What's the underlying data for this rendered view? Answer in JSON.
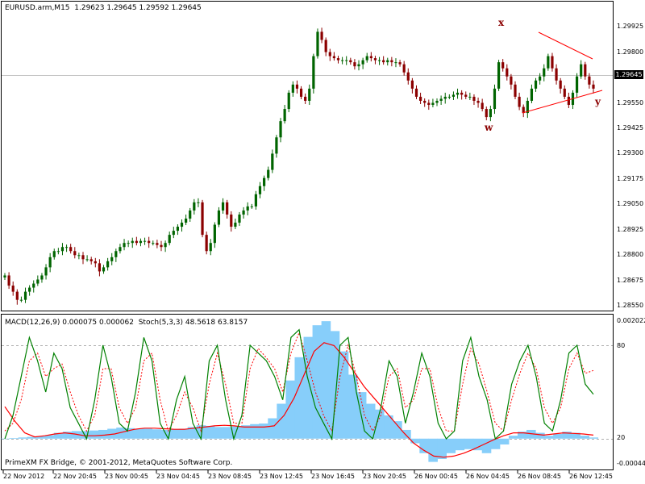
{
  "symbol_info": {
    "symbol": "EURUSD.arm,M15",
    "open": "1.29623",
    "high": "1.29645",
    "low": "1.29592",
    "close": "1.29645"
  },
  "indicator_info": {
    "macd": "MACD(12,26,9) 0.000075 0.000062",
    "stoch": "Stoch(5,3,3) 48.5618 63.8157"
  },
  "footer_text": "PrimeXM FX Bridge, © 2001-2012, MetaQuotes Software Corp.",
  "current_price": "1.29645",
  "price_axis": [
    "1.29925",
    "1.29800",
    "1.29675",
    "1.29550",
    "1.29425",
    "1.29300",
    "1.29175",
    "1.29050",
    "1.28925",
    "1.28800",
    "1.28675",
    "1.28550"
  ],
  "indicator_axis": [
    "0.002022",
    "80",
    "20",
    "-0.000447"
  ],
  "time_axis": [
    "22 Nov 2012",
    "22 Nov 20:45",
    "23 Nov 00:45",
    "23 Nov 04:45",
    "23 Nov 08:45",
    "23 Nov 12:45",
    "23 Nov 16:45",
    "23 Nov 20:45",
    "26 Nov 00:45",
    "26 Nov 04:45",
    "26 Nov 08:45",
    "26 Nov 12:45"
  ],
  "wave_labels": [
    "x",
    "w",
    "y"
  ],
  "colors": {
    "bull_candle": "#006400",
    "bear_candle": "#8b0000",
    "macd_histogram": "#87cefa",
    "macd_signal": "#ff0000",
    "stoch_main": "#008000",
    "stoch_signal": "#ff0000",
    "trendline": "#ff0000"
  },
  "chart_data": {
    "type": "candlestick",
    "timeframe": "M15",
    "ylim": [
      1.28535,
      1.29985
    ],
    "candles_close_approx": [
      1.287,
      1.2865,
      1.2862,
      1.2858,
      1.2858,
      1.2862,
      1.2864,
      1.2866,
      1.2868,
      1.287,
      1.2874,
      1.2879,
      1.2882,
      1.2882,
      1.2884,
      1.2884,
      1.2882,
      1.288,
      1.288,
      1.2878,
      1.2878,
      1.2877,
      1.2876,
      1.2872,
      1.2874,
      1.2877,
      1.2879,
      1.2882,
      1.2884,
      1.2886,
      1.2886,
      1.2887,
      1.2886,
      1.2887,
      1.2887,
      1.2886,
      1.2886,
      1.2885,
      1.2884,
      1.2886,
      1.289,
      1.2892,
      1.2894,
      1.2896,
      1.2898,
      1.2902,
      1.2906,
      1.2906,
      1.289,
      1.2882,
      1.2886,
      1.2895,
      1.2902,
      1.2906,
      1.29,
      1.2894,
      1.2896,
      1.29,
      1.2902,
      1.2904,
      1.2904,
      1.291,
      1.2914,
      1.2918,
      1.2922,
      1.293,
      1.2938,
      1.2946,
      1.2952,
      1.296,
      1.2964,
      1.2962,
      1.2958,
      1.2956,
      1.2962,
      1.2978,
      1.299,
      1.2986,
      1.298,
      1.2978,
      1.2977,
      1.2976,
      1.2976,
      1.2976,
      1.2975,
      1.2973,
      1.2974,
      1.2976,
      1.2978,
      1.2977,
      1.2976,
      1.2976,
      1.2975,
      1.2976,
      1.2975,
      1.2975,
      1.2974,
      1.297,
      1.2966,
      1.2962,
      1.2958,
      1.2956,
      1.2955,
      1.2954,
      1.2955,
      1.2956,
      1.2957,
      1.2958,
      1.2958,
      1.2959,
      1.296,
      1.2959,
      1.2958,
      1.2958,
      1.2956,
      1.2955,
      1.2952,
      1.2948,
      1.2952,
      1.2962,
      1.2975,
      1.2972,
      1.2968,
      1.2964,
      1.2958,
      1.2953,
      1.295,
      1.2956,
      1.2962,
      1.2966,
      1.2968,
      1.2972,
      1.2978,
      1.2972,
      1.2966,
      1.2962,
      1.2958,
      1.2954,
      1.296,
      1.2968,
      1.2974,
      1.2968,
      1.2964,
      1.2962
    ],
    "macd": {
      "histogram_approx": [
        0.0,
        1e-05,
        2e-05,
        3e-05,
        4e-05,
        6e-05,
        0.0001,
        0.00012,
        0.00013,
        0.00013,
        0.00014,
        0.00015,
        0.00017,
        0.00019,
        0.00018,
        0.00017,
        0.00017,
        0.00016,
        0.00015,
        0.00016,
        0.00017,
        0.0002,
        0.00023,
        0.00022,
        0.0002,
        0.0002,
        0.00021,
        0.00023,
        0.00025,
        0.00026,
        0.00035,
        0.0006,
        0.001,
        0.0014,
        0.00175,
        0.00195,
        0.00202,
        0.00185,
        0.0015,
        0.0011,
        0.0008,
        0.0006,
        0.0005,
        0.0004,
        0.0003,
        0.00015,
        -8e-05,
        -0.00025,
        -0.0004,
        -0.00035,
        -0.00025,
        -0.0002,
        -0.00018,
        -0.0002,
        -0.00025,
        -0.00018,
        -0.0001,
        5e-05,
        0.00012,
        0.00015,
        0.0001,
        5e-05,
        8e-05,
        0.00012,
        0.0001,
        5e-05,
        2e-05
      ],
      "signal_approx": [
        0.00055,
        0.0003,
        0.0001,
        3e-05,
        5e-05,
        8e-05,
        0.0001,
        8e-05,
        5e-05,
        5e-05,
        6e-05,
        8e-05,
        0.00012,
        0.00016,
        0.00018,
        0.00018,
        0.00017,
        0.00016,
        0.00016,
        0.00018,
        0.0002,
        0.00022,
        0.00023,
        0.00022,
        0.0002,
        0.0002,
        0.0002,
        0.00022,
        0.0004,
        0.0007,
        0.0011,
        0.0015,
        0.00165,
        0.0016,
        0.0014,
        0.00115,
        0.0009,
        0.0007,
        0.0005,
        0.0003,
        0.0001,
        -8e-05,
        -0.0002,
        -0.0003,
        -0.00032,
        -0.0003,
        -0.00025,
        -0.00018,
        -0.0001,
        -2e-05,
        5e-05,
        0.0001,
        0.0001,
        8e-05,
        6e-05,
        8e-05,
        0.0001,
        9e-05,
        8e-05,
        6e-05
      ]
    },
    "stochastic": {
      "main_approx": [
        20,
        35,
        60,
        85,
        70,
        50,
        75,
        65,
        40,
        30,
        20,
        45,
        80,
        60,
        30,
        25,
        50,
        85,
        70,
        30,
        20,
        45,
        60,
        30,
        20,
        70,
        80,
        45,
        20,
        35,
        80,
        75,
        70,
        60,
        45,
        85,
        90,
        60,
        40,
        30,
        20,
        80,
        85,
        50,
        25,
        20,
        40,
        70,
        60,
        30,
        50,
        75,
        60,
        30,
        20,
        25,
        70,
        85,
        60,
        45,
        20,
        25,
        55,
        70,
        80,
        60,
        30,
        25,
        45,
        75,
        80,
        55,
        48.56
      ],
      "signal_approx": [
        25,
        30,
        45,
        70,
        75,
        60,
        65,
        68,
        50,
        35,
        25,
        35,
        65,
        65,
        40,
        30,
        40,
        70,
        75,
        45,
        25,
        35,
        50,
        40,
        25,
        55,
        75,
        55,
        30,
        30,
        65,
        78,
        72,
        65,
        50,
        75,
        88,
        70,
        50,
        35,
        25,
        60,
        80,
        60,
        35,
        25,
        35,
        60,
        65,
        40,
        45,
        65,
        65,
        40,
        25,
        25,
        55,
        78,
        68,
        50,
        30,
        25,
        45,
        62,
        75,
        65,
        40,
        30,
        40,
        65,
        75,
        62,
        63.82
      ]
    }
  }
}
